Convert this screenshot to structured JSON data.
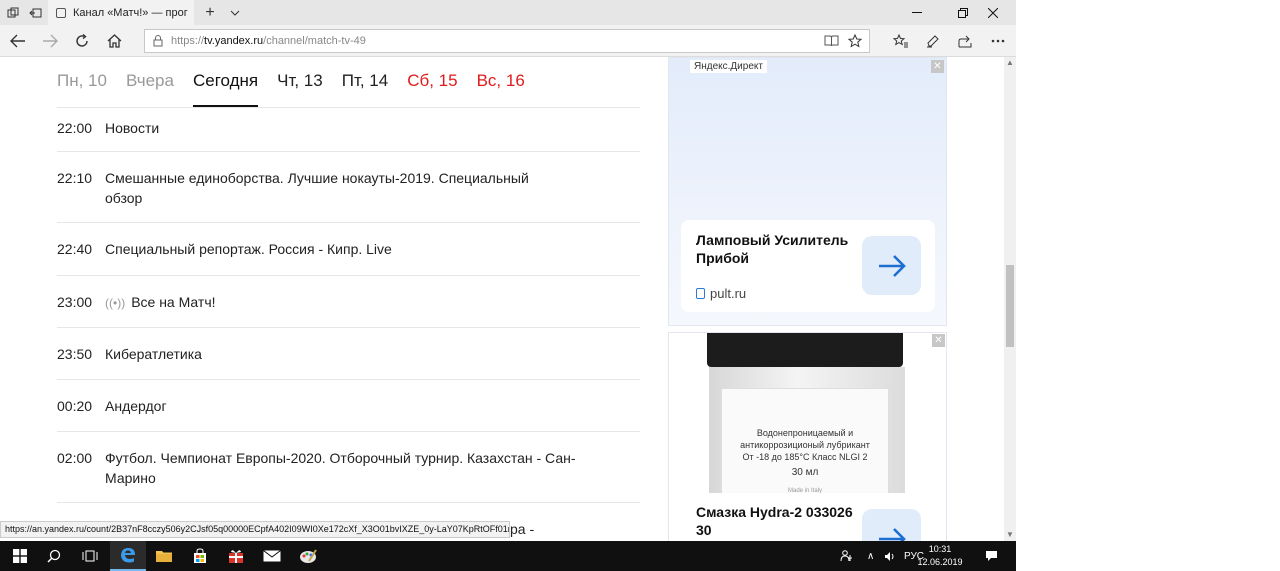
{
  "browser": {
    "tab_title": "Канал «Матч!» — прог",
    "address": {
      "scheme": "https://",
      "host": "tv.yandex.ru",
      "path": "/channel/match-tv-49"
    },
    "status_url": "https://an.yandex.ru/count/2B37nF8cczy506y2CJsf05q00000ECpfA402I09WI0Xe172cXf_X3O01bvIXZE_0y-LaY07KpRtOFf01m8BN\\",
    "overflow_text": "ра -"
  },
  "days": [
    {
      "label": "Пн, 10",
      "state": "past"
    },
    {
      "label": "Вчера",
      "state": "past"
    },
    {
      "label": "Сегодня",
      "state": "active"
    },
    {
      "label": "Чт, 13",
      "state": "future"
    },
    {
      "label": "Пт, 14",
      "state": "future"
    },
    {
      "label": "Сб, 15",
      "state": "weekend"
    },
    {
      "label": "Вс, 16",
      "state": "weekend"
    }
  ],
  "schedule": [
    {
      "time": "22:00",
      "title": "Новости",
      "live": false
    },
    {
      "time": "22:10",
      "title": "Смешанные единоборства. Лучшие нокауты-2019. Специальный обзор",
      "live": false
    },
    {
      "time": "22:40",
      "title": "Специальный репортаж. Россия - Кипр. Live",
      "live": false
    },
    {
      "time": "23:00",
      "title": "Все на Матч!",
      "live": true
    },
    {
      "time": "23:50",
      "title": "Кибератлетика",
      "live": false
    },
    {
      "time": "00:20",
      "title": "Андердог",
      "live": false
    },
    {
      "time": "02:00",
      "title": "Футбол. Чемпионат Европы-2020. Отборочный турнир. Казахстан - Сан-Марино",
      "live": false
    }
  ],
  "ads": {
    "label": "Яндекс.Директ",
    "ad1": {
      "title": "Ламповый Усилитель Прибой",
      "domain": "pult.ru"
    },
    "ad2": {
      "title": "Смазка Hydra-2 033026 30",
      "bottle_line1": "Водонепроницаемый и",
      "bottle_line2": "антикоррозиционый лубрикант",
      "bottle_line3": "От -18 до 185°С Класс NLGI 2",
      "bottle_volume": "30 мл",
      "bottle_made": "Made in Italy"
    }
  },
  "taskbar": {
    "language": "РУС",
    "time": "10:31",
    "date": "12.06.2019"
  },
  "colors": {
    "weekend": "#e01b1b",
    "accent_blue": "#2a7bd4",
    "taskbar": "#101010"
  }
}
